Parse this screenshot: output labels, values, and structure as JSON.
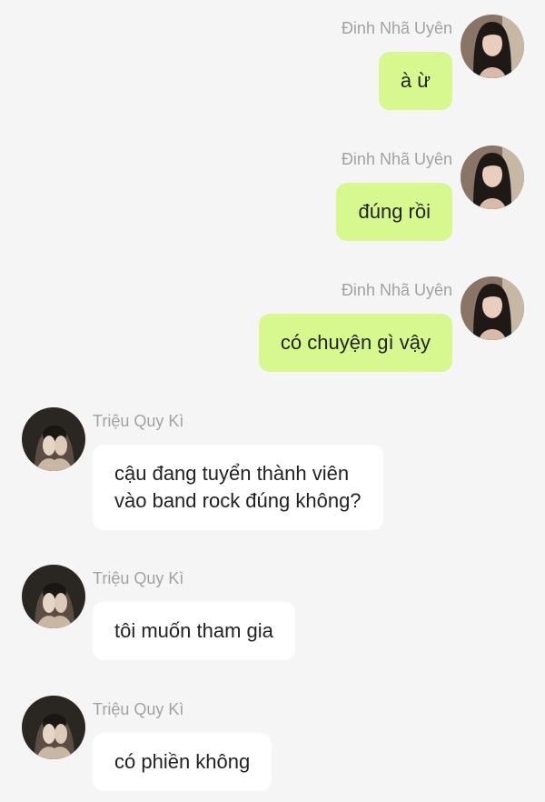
{
  "theme": {
    "background": "#f5f5f5",
    "outgoing_bubble": "#d7f88f",
    "incoming_bubble": "#ffffff",
    "name_color": "#a2a2a2"
  },
  "messages": [
    {
      "direction": "outgoing",
      "sender": "Đinh Nhã Uyên",
      "text": "à ừ",
      "avatar": "female-avatar"
    },
    {
      "direction": "outgoing",
      "sender": "Đinh Nhã Uyên",
      "text": "đúng rồi",
      "avatar": "female-avatar"
    },
    {
      "direction": "outgoing",
      "sender": "Đinh Nhã Uyên",
      "text": "có chuyện gì vậy",
      "avatar": "female-avatar"
    },
    {
      "direction": "incoming",
      "sender": "Triệu Quy Kì",
      "text": "cậu đang tuyển thành viên\nvào band rock đúng không?",
      "avatar": "male-avatar"
    },
    {
      "direction": "incoming",
      "sender": "Triệu Quy Kì",
      "text": "tôi muốn tham gia",
      "avatar": "male-avatar"
    },
    {
      "direction": "incoming",
      "sender": "Triệu Quy Kì",
      "text": "có phiền không",
      "avatar": "male-avatar"
    }
  ]
}
